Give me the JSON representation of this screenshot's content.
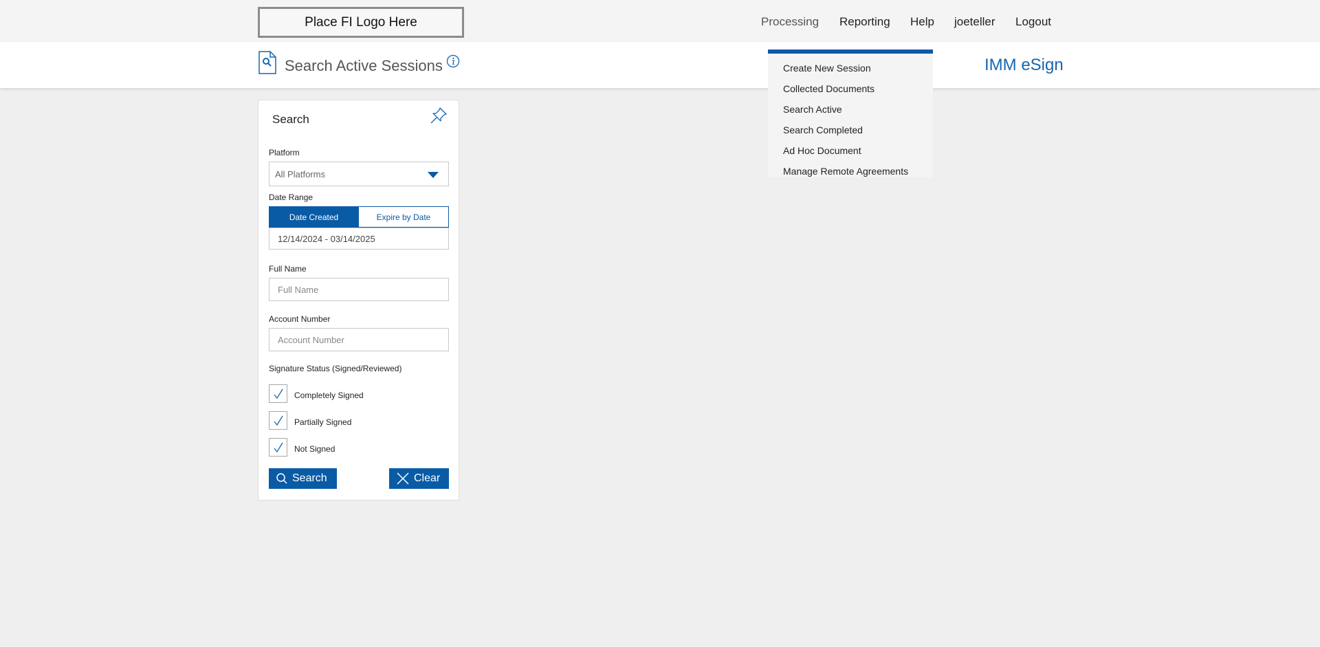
{
  "header": {
    "logo_text": "Place FI Logo Here",
    "nav": [
      "Processing",
      "Reporting",
      "Help",
      "joeteller",
      "Logout"
    ]
  },
  "subheader": {
    "page_title": "Search Active Sessions",
    "app_name": "IMM eSign"
  },
  "processing_menu": {
    "items": [
      "Create New Session",
      "Collected Documents",
      "Search Active",
      "Search Completed",
      "Ad Hoc Document",
      "Manage Remote Agreements"
    ]
  },
  "search_panel": {
    "title": "Search",
    "platform_label": "Platform",
    "platform_value": "All Platforms",
    "date_range_label": "Date Range",
    "date_created_label": "Date Created",
    "expire_by_date_label": "Expire by Date",
    "date_range_value": "12/14/2024 - 03/14/2025",
    "full_name_label": "Full Name",
    "full_name_placeholder": "Full Name",
    "account_number_label": "Account Number",
    "account_number_placeholder": "Account Number",
    "signature_status_label": "Signature Status (Signed/Reviewed)",
    "status_options": [
      {
        "label": "Completely Signed",
        "checked": true
      },
      {
        "label": "Partially Signed",
        "checked": true
      },
      {
        "label": "Not Signed",
        "checked": true
      }
    ],
    "search_button": "Search",
    "clear_button": "Clear"
  },
  "colors": {
    "accent": "#0a5ba6",
    "app_name": "#1766b0",
    "page_background": "#efefef"
  }
}
